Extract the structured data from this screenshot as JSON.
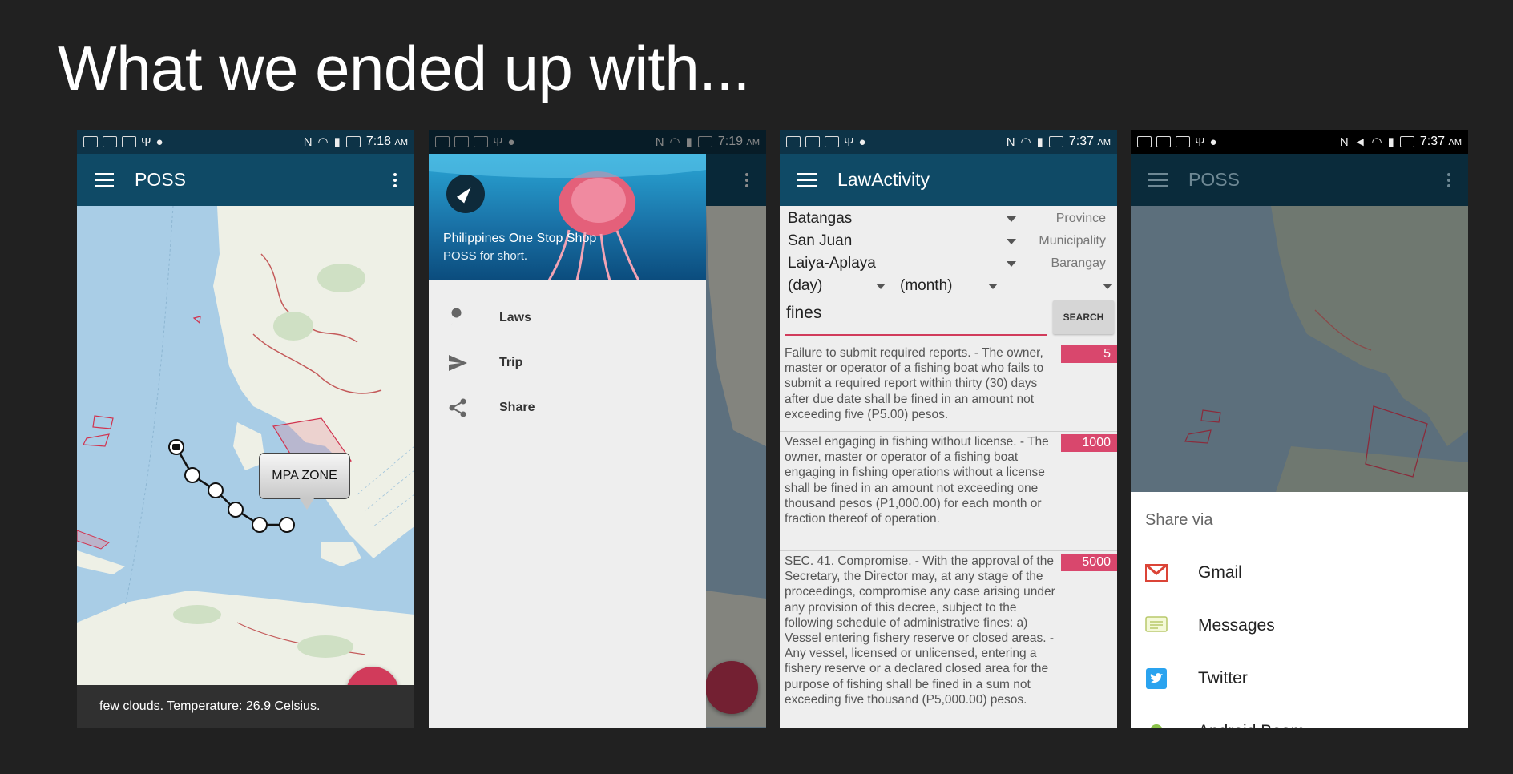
{
  "slide": {
    "title": "What we ended up with..."
  },
  "colors": {
    "background": "#212121",
    "appbar": "#0f4a66",
    "statusbar": "#0d3347",
    "accent": "#d13b5b"
  },
  "screens": [
    {
      "status_time": "7:18",
      "status_ampm": "AM",
      "app_title": "POSS",
      "map": {
        "callout": "MPA ZONE"
      },
      "weather": "few clouds. Temperature: 26.9 Celsius."
    },
    {
      "status_time": "7:19",
      "status_ampm": "AM",
      "drawer": {
        "title": "Philippines One Stop Shop",
        "subtitle": "POSS for short.",
        "items": [
          {
            "label": "Laws",
            "icon": "wrench-icon"
          },
          {
            "label": "Trip",
            "icon": "send-icon"
          },
          {
            "label": "Share",
            "icon": "share-icon"
          }
        ]
      }
    },
    {
      "status_time": "7:37",
      "status_ampm": "AM",
      "app_title": "LawActivity",
      "filters": [
        {
          "value": "Batangas",
          "hint": "Province"
        },
        {
          "value": "San Juan",
          "hint": "Municipality"
        },
        {
          "value": "Laiya-Aplaya",
          "hint": "Barangay"
        }
      ],
      "date_filter": {
        "day": "(day)",
        "month": "(month)"
      },
      "search": {
        "value": "fines",
        "button": "SEARCH"
      },
      "laws": [
        {
          "text": "Failure to submit required reports. - The owner, master or operator of a fishing boat who fails to submit a required report within thirty (30) days after due date shall be fined in an amount not exceeding five (P5.00) pesos.",
          "fine": "5"
        },
        {
          "text": "Vessel engaging in fishing without license. - The owner, master or operator of a fishing boat engaging in fishing operations without a license shall be fined in an amount not exceeding one thousand pesos (P1,000.00) for each month or fraction thereof of operation.",
          "fine": "1000"
        },
        {
          "text": "SEC. 41.  Compromise. - With the approval of the Secretary, the Director may, at any stage of the proceedings, compromise any case arising under any provision of this decree, subject to the following schedule of administrative fines: a) Vessel entering fishery reserve or closed areas. - Any vessel, licensed or unlicensed, entering a fishery reserve or a declared closed area for the purpose of fishing shall be fined in a sum not exceeding five thousand (P5,000.00) pesos.",
          "fine": "5000"
        }
      ]
    },
    {
      "status_time": "7:37",
      "status_ampm": "AM",
      "app_title": "POSS",
      "share": {
        "title": "Share via",
        "items": [
          {
            "label": "Gmail",
            "icon": "gmail-icon"
          },
          {
            "label": "Messages",
            "icon": "messages-icon"
          },
          {
            "label": "Twitter",
            "icon": "twitter-icon"
          },
          {
            "label": "Android Beam",
            "icon": "android-icon"
          }
        ]
      }
    }
  ]
}
